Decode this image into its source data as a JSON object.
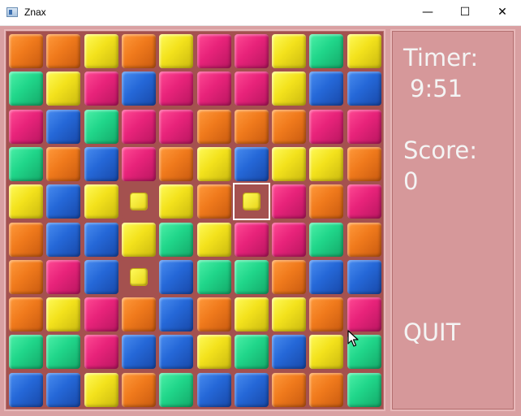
{
  "window": {
    "title": "Znax",
    "minimize_glyph": "—",
    "maximize_glyph": "☐",
    "close_glyph": "✕"
  },
  "colors": {
    "orange": "#f07a1c",
    "yellow": "#f3e21c",
    "green": "#20d68a",
    "pink": "#e8237a",
    "blue": "#2568d8",
    "board_bg": "#a4514f",
    "panel_bg": "#d6989a"
  },
  "board": {
    "rows": 10,
    "cols": 10,
    "grid": [
      [
        "orange",
        "orange",
        "yellow",
        "orange",
        "yellow",
        "pink",
        "pink",
        "yellow",
        "green",
        "yellow"
      ],
      [
        "green",
        "yellow",
        "pink",
        "blue",
        "pink",
        "pink",
        "pink",
        "yellow",
        "blue",
        "blue"
      ],
      [
        "pink",
        "blue",
        "green",
        "pink",
        "pink",
        "orange",
        "orange",
        "orange",
        "pink",
        "pink"
      ],
      [
        "green",
        "orange",
        "blue",
        "pink",
        "orange",
        "yellow",
        "blue",
        "yellow",
        "yellow",
        "orange"
      ],
      [
        "yellow",
        "blue",
        "yellow",
        "empty",
        "yellow",
        "orange",
        "empty",
        "pink",
        "orange",
        "pink"
      ],
      [
        "orange",
        "blue",
        "blue",
        "yellow",
        "green",
        "yellow",
        "pink",
        "pink",
        "green",
        "orange"
      ],
      [
        "orange",
        "pink",
        "blue",
        "empty",
        "blue",
        "green",
        "green",
        "orange",
        "blue",
        "blue"
      ],
      [
        "orange",
        "yellow",
        "pink",
        "orange",
        "blue",
        "orange",
        "yellow",
        "yellow",
        "orange",
        "pink"
      ],
      [
        "green",
        "green",
        "pink",
        "blue",
        "blue",
        "yellow",
        "green",
        "blue",
        "yellow",
        "green"
      ],
      [
        "blue",
        "blue",
        "yellow",
        "orange",
        "green",
        "blue",
        "blue",
        "orange",
        "orange",
        "green"
      ]
    ],
    "selection_markers": [
      {
        "row": 4,
        "col": 3
      },
      {
        "row": 4,
        "col": 6
      },
      {
        "row": 6,
        "col": 3
      }
    ],
    "cursor": {
      "row": 4,
      "col": 6
    }
  },
  "panel": {
    "timer_label": "Timer:",
    "timer_value": "9:51",
    "score_label": "Score:",
    "score_value": "0",
    "quit_label": "QUIT"
  },
  "icons": {
    "app": "app-window-icon",
    "pointer": "mouse-pointer-icon"
  }
}
